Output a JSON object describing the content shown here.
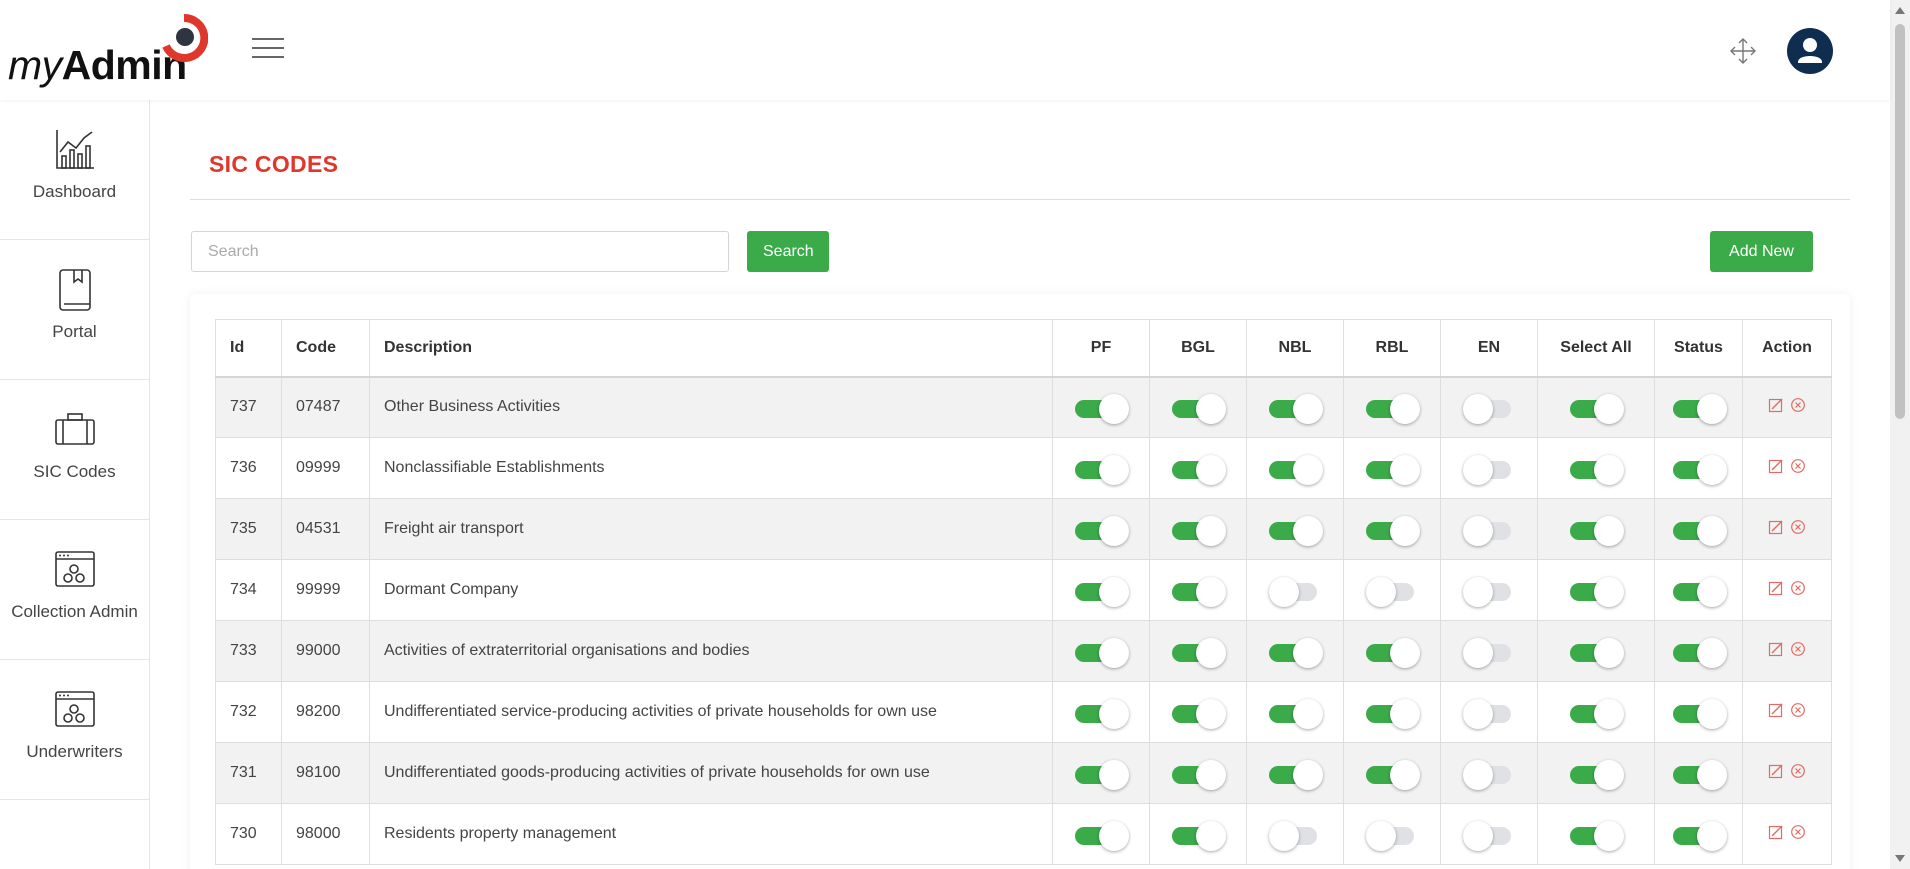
{
  "brand": {
    "logo_my": "my",
    "logo_admin": "Admin"
  },
  "colors": {
    "accent": "#e0372c",
    "success": "#3bab4a",
    "avatar_bg": "#0f2d4f"
  },
  "header": {
    "menu_icon": "hamburger-icon",
    "fullscreen_icon": "fullscreen-icon",
    "user_icon": "user-icon"
  },
  "sidebar": {
    "items": [
      {
        "label": "Dashboard",
        "icon": "chart-icon"
      },
      {
        "label": "Portal",
        "icon": "book-icon"
      },
      {
        "label": "SIC Codes",
        "icon": "briefcase-icon"
      },
      {
        "label": "Collection Admin",
        "icon": "window-gears-icon"
      },
      {
        "label": "Underwriters",
        "icon": "window-gears-icon"
      }
    ]
  },
  "page": {
    "title": "SIC CODES",
    "search_placeholder": "Search",
    "search_value": "",
    "search_button": "Search",
    "add_button": "Add New"
  },
  "table": {
    "headers": [
      "Id",
      "Code",
      "Description",
      "PF",
      "BGL",
      "NBL",
      "RBL",
      "EN",
      "Select All",
      "Status",
      "Action"
    ],
    "rows": [
      {
        "id": "737",
        "code": "07487",
        "description": "Other Business Activities",
        "pf": true,
        "bgl": true,
        "nbl": true,
        "rbl": true,
        "en": false,
        "select_all": true,
        "status": true
      },
      {
        "id": "736",
        "code": "09999",
        "description": "Nonclassifiable Establishments",
        "pf": true,
        "bgl": true,
        "nbl": true,
        "rbl": true,
        "en": false,
        "select_all": true,
        "status": true
      },
      {
        "id": "735",
        "code": "04531",
        "description": "Freight air transport",
        "pf": true,
        "bgl": true,
        "nbl": true,
        "rbl": true,
        "en": false,
        "select_all": true,
        "status": true
      },
      {
        "id": "734",
        "code": "99999",
        "description": "Dormant Company",
        "pf": true,
        "bgl": true,
        "nbl": false,
        "rbl": false,
        "en": false,
        "select_all": true,
        "status": true
      },
      {
        "id": "733",
        "code": "99000",
        "description": "Activities of extraterritorial organisations and bodies",
        "pf": true,
        "bgl": true,
        "nbl": true,
        "rbl": true,
        "en": false,
        "select_all": true,
        "status": true
      },
      {
        "id": "732",
        "code": "98200",
        "description": "Undifferentiated service-producing activities of private households for own use",
        "pf": true,
        "bgl": true,
        "nbl": true,
        "rbl": true,
        "en": false,
        "select_all": true,
        "status": true
      },
      {
        "id": "731",
        "code": "98100",
        "description": "Undifferentiated goods-producing activities of private households for own use",
        "pf": true,
        "bgl": true,
        "nbl": true,
        "rbl": true,
        "en": false,
        "select_all": true,
        "status": true
      },
      {
        "id": "730",
        "code": "98000",
        "description": "Residents property management",
        "pf": true,
        "bgl": true,
        "nbl": false,
        "rbl": false,
        "en": false,
        "select_all": true,
        "status": true
      }
    ],
    "action_icons": [
      "edit-icon",
      "delete-icon"
    ]
  }
}
